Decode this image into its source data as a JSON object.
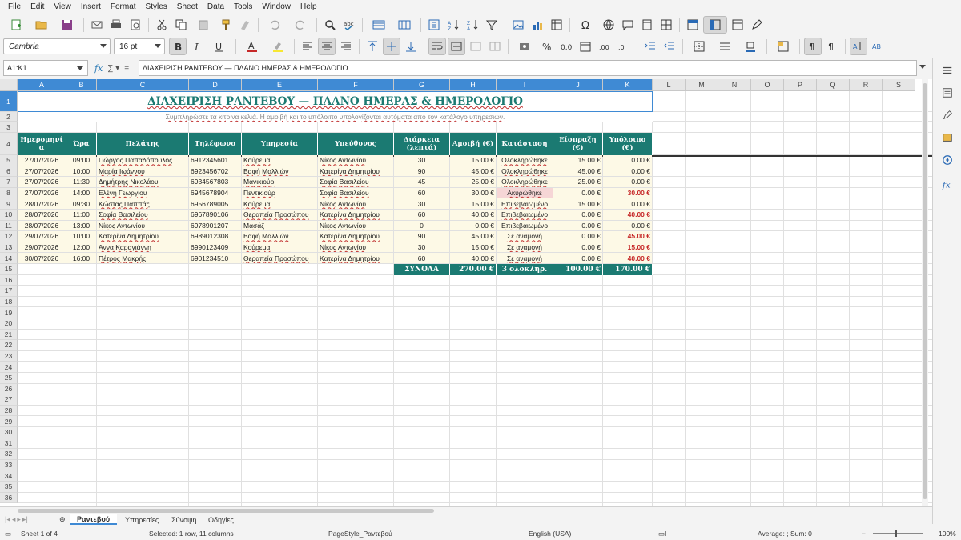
{
  "menu": [
    "File",
    "Edit",
    "View",
    "Insert",
    "Format",
    "Styles",
    "Sheet",
    "Data",
    "Tools",
    "Window",
    "Help"
  ],
  "font": {
    "name": "Cambria",
    "size": "16 pt"
  },
  "formula_bar": {
    "name_box": "A1:K1",
    "content": "ΔΙΑΧΕΙΡΙΣΗ ΡΑΝΤΕΒΟΥ — ΠΛΑΝΟ ΗΜΕΡΑΣ & ΗΜΕΡΟΛΟΓΙΟ"
  },
  "columns": [
    "A",
    "B",
    "C",
    "D",
    "E",
    "F",
    "G",
    "H",
    "I",
    "J",
    "K",
    "L",
    "M",
    "N",
    "O",
    "P",
    "Q",
    "R",
    "S"
  ],
  "selected_columns": [
    "A",
    "B",
    "C",
    "D",
    "E",
    "F",
    "G",
    "H",
    "I",
    "J",
    "K"
  ],
  "rows_visible": 36,
  "sheet": {
    "title": "ΔΙΑΧΕΙΡΙΣΗ ΡΑΝΤΕΒΟΥ — ΠΛΑΝΟ ΗΜΕΡΑΣ & ΗΜΕΡΟΛΟΓΙΟ",
    "subtitle": "Συμπληρώστε τα κίτρινα κελιά. Η αμοιβή και το υπόλοιπο υπολογίζονται αυτόματα από τον κατάλογο υπηρεσιών.",
    "headers": [
      "Ημερομηνί\nα",
      "Ώρα",
      "Πελάτης",
      "Τηλέφωνο",
      "Υπηρεσία",
      "Υπεύθυνος",
      "Διάρκεια\n(λεπτά)",
      "Αμοιβή (€)",
      "Κατάσταση",
      "Είσπραξη\n(€)",
      "Υπόλοιπο\n(€)"
    ],
    "rows": [
      [
        "27/07/2026",
        "09:00",
        "Γιώργος Παπαδόπουλος",
        "6912345601",
        "Κούρεμα",
        "Νίκος Αντωνίου",
        "30",
        "15.00 €",
        "Ολοκληρώθηκε",
        "15.00 €",
        "0.00 €"
      ],
      [
        "27/07/2026",
        "10:00",
        "Μαρία Ιωάννου",
        "6923456702",
        "Βαφή Μαλλιών",
        "Κατερίνα Δημητρίου",
        "90",
        "45.00 €",
        "Ολοκληρώθηκε",
        "45.00 €",
        "0.00 €"
      ],
      [
        "27/07/2026",
        "11:30",
        "Δημήτρης Νικολάου",
        "6934567803",
        "Μανικιούρ",
        "Σοφία Βασιλείου",
        "45",
        "25.00 €",
        "Ολοκληρώθηκε",
        "25.00 €",
        "0.00 €"
      ],
      [
        "27/07/2026",
        "14:00",
        "Ελένη Γεωργίου",
        "6945678904",
        "Πεντικιούρ",
        "Σοφία Βασιλείου",
        "60",
        "30.00 €",
        "Ακυρώθηκε",
        "0.00 €",
        "30.00 €"
      ],
      [
        "28/07/2026",
        "09:30",
        "Κώστας Παππάς",
        "6956789005",
        "Κούρεμα",
        "Νίκος Αντωνίου",
        "30",
        "15.00 €",
        "Επιβεβαιωμένο",
        "15.00 €",
        "0.00 €"
      ],
      [
        "28/07/2026",
        "11:00",
        "Σοφία Βασιλείου",
        "6967890106",
        "Θεραπεία Προσώπου",
        "Κατερίνα Δημητρίου",
        "60",
        "40.00 €",
        "Επιβεβαιωμένο",
        "0.00 €",
        "40.00 €"
      ],
      [
        "28/07/2026",
        "13:00",
        "Νίκος Αντωνίου",
        "6978901207",
        "Μασάζ",
        "Νίκος Αντωνίου",
        "0",
        "0.00 €",
        "Επιβεβαιωμένο",
        "0.00 €",
        "0.00 €"
      ],
      [
        "29/07/2026",
        "10:00",
        "Κατερίνα Δημητρίου",
        "6989012308",
        "Βαφή Μαλλιών",
        "Κατερίνα Δημητρίου",
        "90",
        "45.00 €",
        "Σε αναμονή",
        "0.00 €",
        "45.00 €"
      ],
      [
        "29/07/2026",
        "12:00",
        "Άννα Καραγιάννη",
        "6990123409",
        "Κούρεμα",
        "Νίκος Αντωνίου",
        "30",
        "15.00 €",
        "Σε αναμονή",
        "0.00 €",
        "15.00 €"
      ],
      [
        "30/07/2026",
        "16:00",
        "Πέτρος Μακρής",
        "6901234510",
        "Θεραπεία Προσώπου",
        "Κατερίνα Δημητρίου",
        "60",
        "40.00 €",
        "Σε αναμονή",
        "0.00 €",
        "40.00 €"
      ]
    ],
    "totals": {
      "label": "ΣΥΝΟΛΑ",
      "fee": "270.00 €",
      "completed": "3 ολοκληρ.",
      "received": "100.00 €",
      "balance": "170.00 €"
    }
  },
  "tabs": [
    "Ραντεβού",
    "Υπηρεσίες",
    "Σύνοψη",
    "Οδηγίες"
  ],
  "active_tab": "Ραντεβού",
  "status": {
    "sheet": "Sheet 1 of 4",
    "selection": "Selected: 1 row, 11 columns",
    "page_style": "PageStyle_Ραντεβού",
    "language": "English (USA)",
    "sum": "Average: ; Sum: 0",
    "zoom": "100%"
  },
  "colors": {
    "accent": "#1b7a72",
    "selection": "#3f8ad4",
    "row_fill": "#fdf9e6",
    "cancel_fill": "#f6d6d6",
    "balance_red": "#c62828"
  }
}
